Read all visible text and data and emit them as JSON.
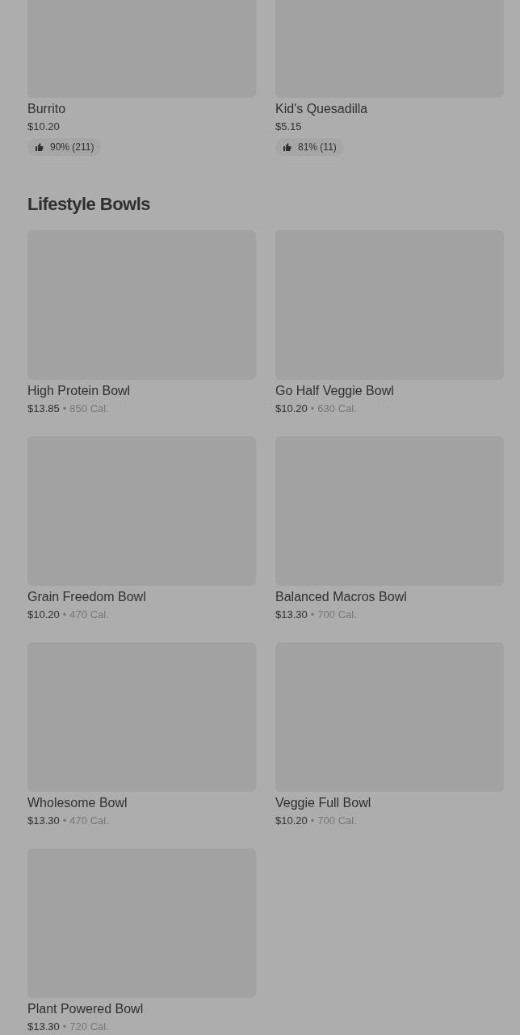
{
  "top_items": [
    {
      "name": "Burrito",
      "price": "$10.20",
      "rating": "90% (211)"
    },
    {
      "name": "Kid's Quesadilla",
      "price": "$5.15",
      "rating": "81% (11)"
    }
  ],
  "section": {
    "title": "Lifestyle Bowls",
    "items": [
      {
        "name": "High Protein Bowl",
        "price": "$13.85",
        "separator": "•",
        "calories": "850 Cal."
      },
      {
        "name": "Go Half Veggie Bowl",
        "price": "$10.20",
        "separator": "•",
        "calories": "630 Cal."
      },
      {
        "name": "Grain Freedom Bowl",
        "price": "$10.20",
        "separator": "•",
        "calories": "470 Cal."
      },
      {
        "name": "Balanced Macros Bowl",
        "price": "$13.30",
        "separator": "•",
        "calories": "700 Cal."
      },
      {
        "name": "Wholesome Bowl",
        "price": "$13.30",
        "separator": "•",
        "calories": "470 Cal."
      },
      {
        "name": "Veggie Full Bowl",
        "price": "$10.20",
        "separator": "•",
        "calories": "700 Cal."
      },
      {
        "name": "Plant Powered Bowl",
        "price": "$13.30",
        "separator": "•",
        "calories": "720 Cal."
      }
    ]
  }
}
